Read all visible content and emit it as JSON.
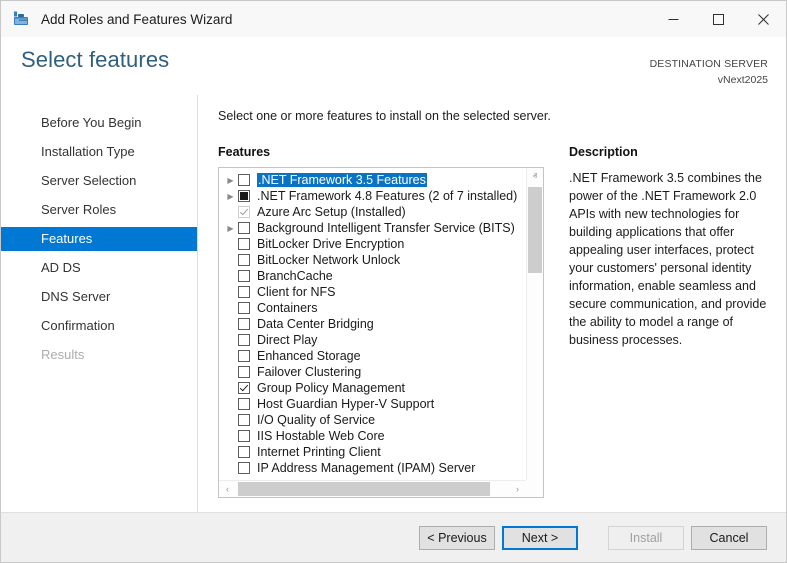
{
  "window": {
    "title": "Add Roles and Features Wizard",
    "icon": "server-roles-icon",
    "minimize_label": "─",
    "maximize_label": "□",
    "close_label": "✕"
  },
  "header": {
    "page_title": "Select features",
    "destination_label": "DESTINATION SERVER",
    "destination_value": "vNext2025"
  },
  "sidebar": {
    "items": [
      {
        "label": "Before You Begin",
        "state": "normal"
      },
      {
        "label": "Installation Type",
        "state": "normal"
      },
      {
        "label": "Server Selection",
        "state": "normal"
      },
      {
        "label": "Server Roles",
        "state": "normal"
      },
      {
        "label": "Features",
        "state": "active"
      },
      {
        "label": "AD DS",
        "state": "normal"
      },
      {
        "label": "DNS Server",
        "state": "normal"
      },
      {
        "label": "Confirmation",
        "state": "normal"
      },
      {
        "label": "Results",
        "state": "disabled"
      }
    ]
  },
  "main": {
    "instruction": "Select one or more features to install on the selected server.",
    "features_label": "Features",
    "description_label": "Description",
    "description_text": ".NET Framework 3.5 combines the power of the .NET Framework 2.0 APIs with new technologies for building applications that offer appealing user interfaces, protect your customers' personal identity information, enable seamless and secure communication, and provide the ability to model a range of business processes."
  },
  "features": [
    {
      "label": ".NET Framework 3.5 Features",
      "checkbox": "unchecked",
      "expander": true,
      "selected": true
    },
    {
      "label": ".NET Framework 4.8 Features (2 of 7 installed)",
      "checkbox": "partial",
      "expander": true,
      "selected": false
    },
    {
      "label": "Azure Arc Setup (Installed)",
      "checkbox": "installed",
      "expander": false,
      "selected": false
    },
    {
      "label": "Background Intelligent Transfer Service (BITS)",
      "checkbox": "unchecked",
      "expander": true,
      "selected": false
    },
    {
      "label": "BitLocker Drive Encryption",
      "checkbox": "unchecked",
      "expander": false,
      "selected": false
    },
    {
      "label": "BitLocker Network Unlock",
      "checkbox": "unchecked",
      "expander": false,
      "selected": false
    },
    {
      "label": "BranchCache",
      "checkbox": "unchecked",
      "expander": false,
      "selected": false
    },
    {
      "label": "Client for NFS",
      "checkbox": "unchecked",
      "expander": false,
      "selected": false
    },
    {
      "label": "Containers",
      "checkbox": "unchecked",
      "expander": false,
      "selected": false
    },
    {
      "label": "Data Center Bridging",
      "checkbox": "unchecked",
      "expander": false,
      "selected": false
    },
    {
      "label": "Direct Play",
      "checkbox": "unchecked",
      "expander": false,
      "selected": false
    },
    {
      "label": "Enhanced Storage",
      "checkbox": "unchecked",
      "expander": false,
      "selected": false
    },
    {
      "label": "Failover Clustering",
      "checkbox": "unchecked",
      "expander": false,
      "selected": false
    },
    {
      "label": "Group Policy Management",
      "checkbox": "checked",
      "expander": false,
      "selected": false
    },
    {
      "label": "Host Guardian Hyper-V Support",
      "checkbox": "unchecked",
      "expander": false,
      "selected": false
    },
    {
      "label": "I/O Quality of Service",
      "checkbox": "unchecked",
      "expander": false,
      "selected": false
    },
    {
      "label": "IIS Hostable Web Core",
      "checkbox": "unchecked",
      "expander": false,
      "selected": false
    },
    {
      "label": "Internet Printing Client",
      "checkbox": "unchecked",
      "expander": false,
      "selected": false
    },
    {
      "label": "IP Address Management (IPAM) Server",
      "checkbox": "unchecked",
      "expander": false,
      "selected": false
    }
  ],
  "scrollbars": {
    "vertical_up_glyph": "ⱏ",
    "vertical_down_glyph": "ⱟ",
    "horizontal_left_glyph": "‹",
    "horizontal_right_glyph": "›"
  },
  "footer": {
    "previous_label": "< Previous",
    "next_label": "Next >",
    "install_label": "Install",
    "cancel_label": "Cancel"
  },
  "colors": {
    "accent": "#0078d4",
    "selection": "#0b73c4",
    "title_text": "#2f5f80",
    "footer_bg": "#f0f0f0"
  }
}
